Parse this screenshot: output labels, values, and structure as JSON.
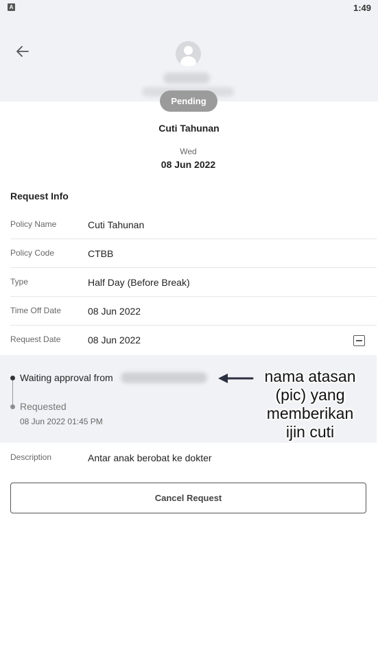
{
  "status_bar": {
    "app_icon": "A",
    "time": "1:49"
  },
  "header": {
    "back_icon": "arrow-left-icon",
    "avatar_icon": "user-avatar-icon"
  },
  "request": {
    "status": "Pending",
    "policy_title": "Cuti Tahunan",
    "day_name": "Wed",
    "date": "08 Jun 2022"
  },
  "info": {
    "section_title": "Request Info",
    "rows": [
      {
        "label": "Policy Name",
        "value": "Cuti Tahunan"
      },
      {
        "label": "Policy Code",
        "value": "CTBB"
      },
      {
        "label": "Type",
        "value": "Half Day (Before Break)"
      },
      {
        "label": "Time Off Date",
        "value": "08 Jun 2022"
      },
      {
        "label": "Request Date",
        "value": "08 Jun 2022"
      }
    ]
  },
  "approval": {
    "waiting_label": "Waiting approval from",
    "requested_label": "Requested",
    "requested_time": "08 Jun 2022 01:45 PM"
  },
  "annotation": {
    "text_lines": [
      "nama atasan",
      "(pic) yang",
      "memberikan",
      "ijin cuti"
    ]
  },
  "description": {
    "label": "Description",
    "value": "Antar anak berobat ke dokter"
  },
  "cancel_button_label": "Cancel Request",
  "colors": {
    "header_bg": "#f1f2f5",
    "pill_bg": "#9b9b9b",
    "annotation_arrow": "#2c3040"
  }
}
